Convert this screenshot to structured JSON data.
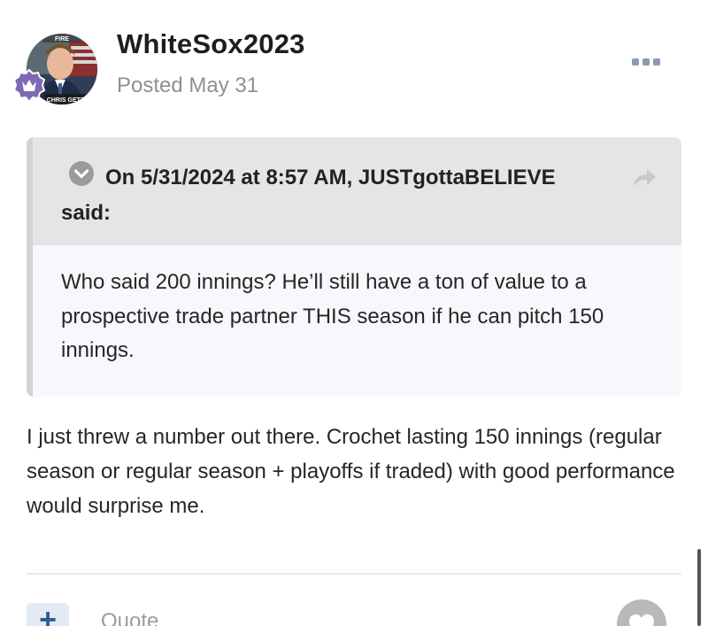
{
  "post": {
    "author": "WhiteSox2023",
    "posted": "Posted May 31",
    "avatar": {
      "sign_top": "FIRE",
      "sign_bottom": "CHRIS GETZ"
    },
    "more_icon": "ellipsis-icon"
  },
  "quote": {
    "citation": "On 5/31/2024 at 8:57 AM, JUSTgottaBELIEVE said:",
    "body": "Who said 200 innings? He’ll still have a ton of value to a prospective trade partner THIS season if he can pitch 150 innings.",
    "toggle_icon": "chevron-down-circle-icon",
    "share_icon": "share-arrow-icon"
  },
  "body_text": "I just threw a number out there.   Crochet lasting 150 innings (regular season or regular season + playoffs if traded) with good performance would surprise me.",
  "actions": {
    "add_label": "+",
    "quote_label": "Quote",
    "react_icon": "heart-icon"
  },
  "colors": {
    "accent": "#2d5a8c",
    "muted": "#8d9096",
    "quote_header_bg": "#e5e5e6",
    "quote_body_bg": "#f6f8fb",
    "badge": "#7d6ab3"
  }
}
